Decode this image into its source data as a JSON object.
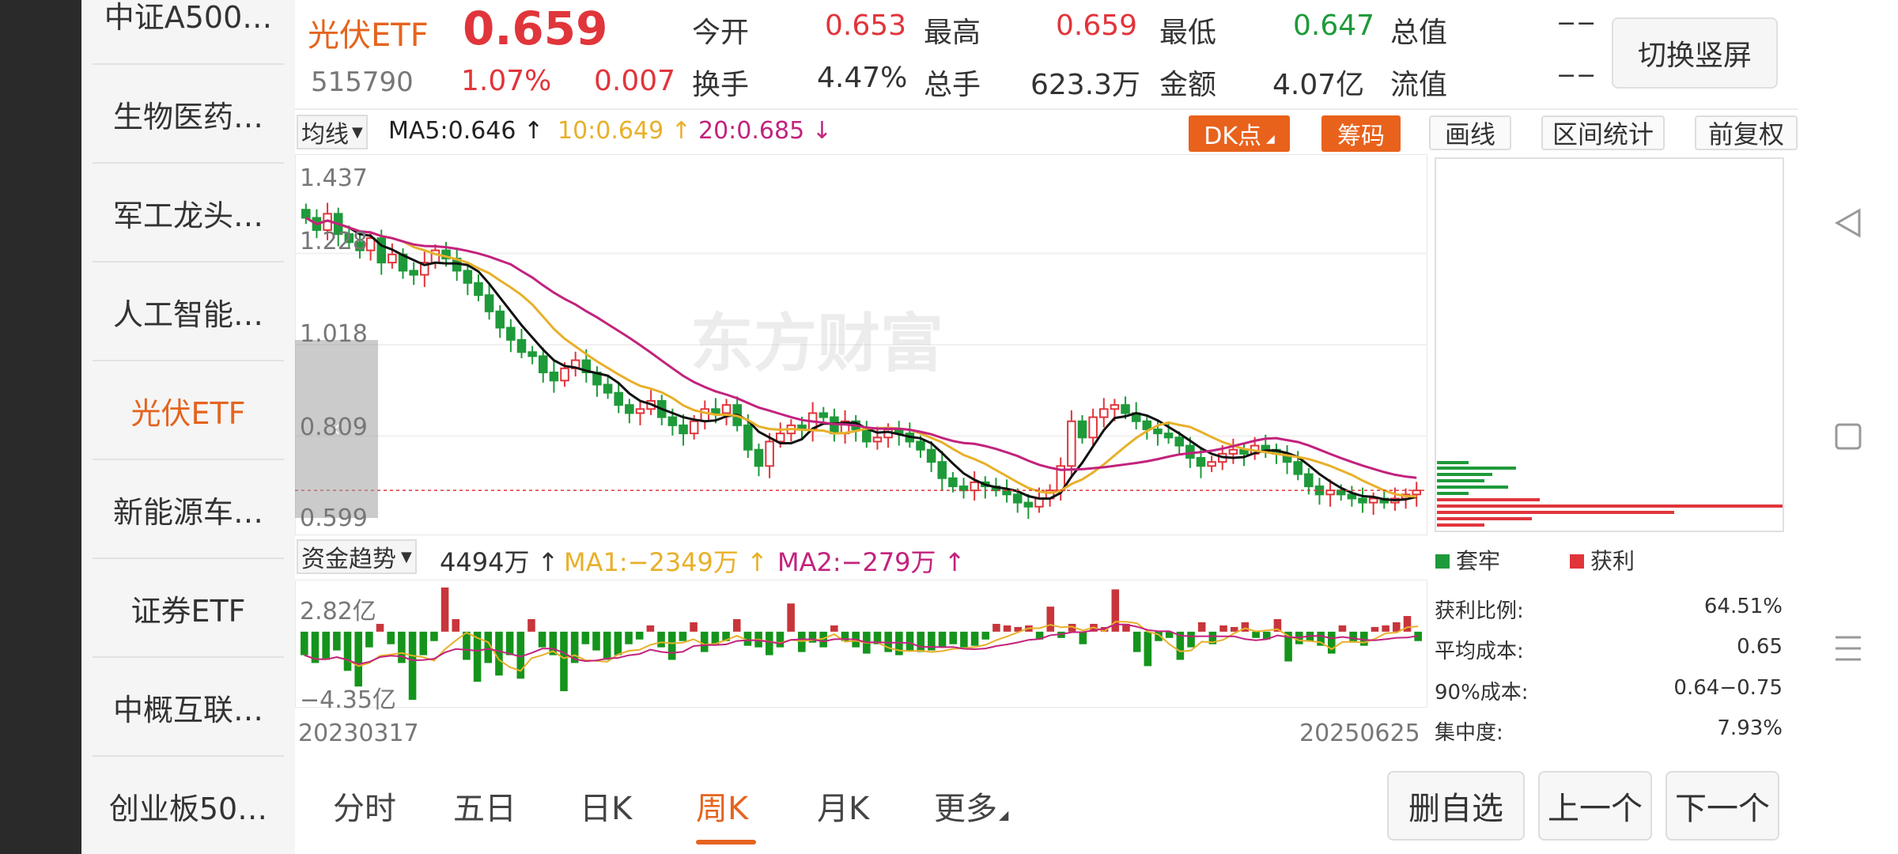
{
  "sidebar": {
    "items": [
      {
        "label": "中证A500…"
      },
      {
        "label": "生物医药…"
      },
      {
        "label": "军工龙头…"
      },
      {
        "label": "人工智能…"
      },
      {
        "label": "光伏ETF",
        "active": true
      },
      {
        "label": "新能源车…"
      },
      {
        "label": "证券ETF"
      },
      {
        "label": "中概互联…"
      },
      {
        "label": "创业板50…"
      }
    ]
  },
  "header": {
    "name": "光伏ETF",
    "price": "0.659",
    "code": "515790",
    "change_pct": "1.07%",
    "change": "0.007",
    "open_label": "今开",
    "open": "0.653",
    "high_label": "最高",
    "high": "0.659",
    "low_label": "最低",
    "low": "0.647",
    "mktcap_label": "总值",
    "mktcap": "−−",
    "turnover_label": "换手",
    "turnover": "4.47%",
    "volume_label": "总手",
    "volume": "623.3万",
    "amount_label": "金额",
    "amount": "4.07亿",
    "float_label": "流值",
    "float": "−−",
    "switch_label": "切换竖屏"
  },
  "toolbar": {
    "ma_select": "均线",
    "ma5": "MA5:0.646 ↑",
    "ma10": "10:0.649 ↑",
    "ma20": "20:0.685 ↓",
    "dk_label": "DK点",
    "chips_label": "筹码",
    "draw_label": "画线",
    "range_label": "区间统计",
    "adjust_label": "前复权"
  },
  "kchart": {
    "y_labels": [
      "1.437",
      "1.228",
      "1.018",
      "0.809",
      "0.599"
    ],
    "watermark": "东方财富",
    "colors": {
      "up": "#e0353b",
      "down": "#1e9a3a",
      "ma5": "#111111",
      "ma10": "#e8b02a",
      "ma20": "#c2237d"
    }
  },
  "fund": {
    "select": "资金趋势",
    "value": "4494万 ↑",
    "ma1": "MA1:−2349万 ↑",
    "ma2": "MA2:−279万 ↑",
    "y_top": "2.82亿",
    "y_bottom": "−4.35亿",
    "date_start": "20230317",
    "date_end": "20250625"
  },
  "chips": {
    "legend_trapped": "套牢",
    "legend_profit": "获利",
    "profit_ratio_label": "获利比例:",
    "profit_ratio": "64.51%",
    "avg_cost_label": "平均成本:",
    "avg_cost": "0.65",
    "cost90_label": "90%成本:",
    "cost90": "0.64−0.75",
    "concentration_label": "集中度:",
    "concentration": "7.93%"
  },
  "bottom": {
    "tabs": [
      "分时",
      "五日",
      "日K",
      "周K",
      "月K",
      "更多"
    ],
    "active_tab": 3,
    "delete_label": "删自选",
    "prev_label": "上一个",
    "next_label": "下一个"
  },
  "chart_data": {
    "type": "candlestick",
    "title": "",
    "xlabel": "",
    "ylabel": "",
    "x_range": [
      "20230317",
      "20250625"
    ],
    "ylim": [
      0.599,
      1.437
    ],
    "closes": [
      1.33,
      1.3,
      1.34,
      1.29,
      1.27,
      1.25,
      1.28,
      1.22,
      1.24,
      1.2,
      1.19,
      1.22,
      1.25,
      1.23,
      1.2,
      1.17,
      1.14,
      1.1,
      1.06,
      1.03,
      1.0,
      0.99,
      0.95,
      0.93,
      0.96,
      0.98,
      0.95,
      0.92,
      0.9,
      0.87,
      0.85,
      0.86,
      0.88,
      0.84,
      0.82,
      0.8,
      0.83,
      0.86,
      0.85,
      0.87,
      0.82,
      0.76,
      0.72,
      0.78,
      0.8,
      0.82,
      0.81,
      0.85,
      0.84,
      0.8,
      0.83,
      0.81,
      0.78,
      0.79,
      0.81,
      0.8,
      0.78,
      0.76,
      0.73,
      0.69,
      0.67,
      0.66,
      0.68,
      0.67,
      0.66,
      0.65,
      0.63,
      0.62,
      0.64,
      0.66,
      0.72,
      0.83,
      0.79,
      0.84,
      0.86,
      0.87,
      0.85,
      0.83,
      0.81,
      0.8,
      0.79,
      0.77,
      0.74,
      0.72,
      0.73,
      0.75,
      0.76,
      0.75,
      0.77,
      0.76,
      0.75,
      0.73,
      0.7,
      0.67,
      0.65,
      0.66,
      0.65,
      0.64,
      0.63,
      0.64,
      0.63,
      0.64,
      0.65,
      0.66
    ],
    "fund_flow": [
      -1.5,
      -2.0,
      -1.8,
      -1.2,
      -2.5,
      -3.5,
      -1.0,
      0.5,
      -0.8,
      -2.0,
      -4.35,
      -1.5,
      -0.6,
      2.82,
      0.8,
      -1.8,
      -3.2,
      -2.0,
      -2.8,
      -1.5,
      -3.0,
      0.8,
      -1.0,
      -1.5,
      -3.8,
      -2.0,
      -0.8,
      -1.2,
      -1.8,
      -1.5,
      -0.8,
      -0.5,
      0.4,
      -1.0,
      -1.8,
      -0.6,
      0.6,
      -1.3,
      -0.8,
      -0.6,
      0.8,
      -0.9,
      -1.0,
      -1.5,
      -1.0,
      1.8,
      -1.3,
      -0.7,
      -1.0,
      0.4,
      -0.6,
      -1.0,
      -1.4,
      -0.8,
      -1.3,
      -1.5,
      -1.2,
      -1.3,
      -1.2,
      -1.0,
      -0.8,
      -1.0,
      -0.9,
      -0.5,
      0.5,
      0.4,
      0.3,
      0.4,
      -0.5,
      1.6,
      -0.4,
      0.5,
      -0.8,
      0.5,
      0.3,
      2.7,
      0.5,
      -1.3,
      -2.2,
      -0.6,
      -0.4,
      -1.8,
      -1.0,
      0.6,
      -0.8,
      0.4,
      0.3,
      0.6,
      -0.4,
      -0.5,
      0.8,
      -1.9,
      -0.8,
      -0.6,
      -0.9,
      -1.4,
      0.4,
      -0.7,
      -0.9,
      0.3,
      0.4,
      0.6,
      1.0,
      -0.6
    ]
  }
}
